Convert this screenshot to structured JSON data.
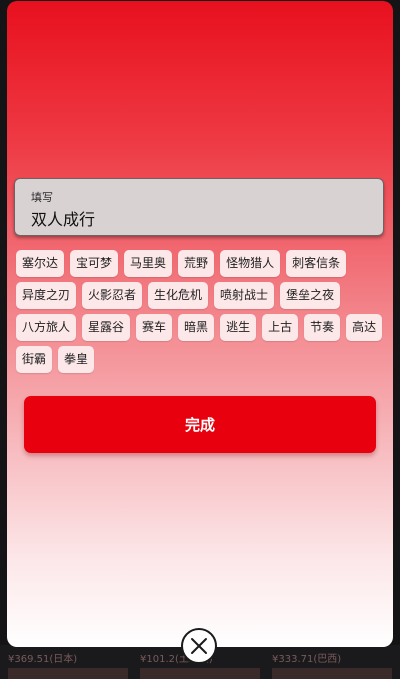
{
  "background": {
    "prices": [
      "¥369.51(日本)",
      "¥101.2(土耳其)",
      "¥333.71(巴西)"
    ]
  },
  "input": {
    "label": "填写",
    "value": "双人成行"
  },
  "tags": [
    "塞尔达",
    "宝可梦",
    "马里奥",
    "荒野",
    "怪物猎人",
    "刺客信条",
    "异度之刃",
    "火影忍者",
    "生化危机",
    "喷射战士",
    "堡垒之夜",
    "八方旅人",
    "星露谷",
    "赛车",
    "暗黑",
    "逃生",
    "上古",
    "节奏",
    "高达",
    "街霸",
    "拳皇"
  ],
  "done_button": {
    "label": "完成"
  },
  "colors": {
    "accent": "#e8000e",
    "tag_background": "#fde8e9",
    "input_background": "#d9d2d3"
  },
  "icons": {
    "close": "close-icon"
  }
}
